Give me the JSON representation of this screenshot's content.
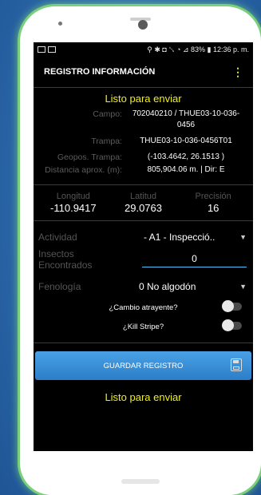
{
  "status_bar": {
    "right": "⚲ ✱ ◘ ␖ ◔ ⊿ 83% ▮ 12:36 p. m."
  },
  "app": {
    "title": "REGISTRO INFORMACIÓN",
    "menu_icon": "⋮"
  },
  "status_message": "Listo para enviar",
  "details": [
    {
      "label": "Campo:",
      "value": "702040210 / THUE03-10-036-0456"
    },
    {
      "label": "Trampa:",
      "value": "THUE03-10-036-0456T01"
    },
    {
      "label": "Geopos. Trampa:",
      "value": "(-103.4642, 26.1513 )"
    },
    {
      "label": "Distancia aprox. (m):",
      "value": "805,904.06 m. | Dir: E"
    }
  ],
  "coords": {
    "longitud": {
      "label": "Longitud",
      "value": "-110.9417"
    },
    "latitud": {
      "label": "Latitud",
      "value": "29.0763"
    },
    "precision": {
      "label": "Precisión",
      "value": "16"
    }
  },
  "form": {
    "actividad": {
      "label": "Actividad",
      "value": "- A1 - Inspecció.."
    },
    "insectos": {
      "label": "Insectos Encontrados",
      "value": "0"
    },
    "fenologia": {
      "label": "Fenología",
      "value": "0 No algodón"
    },
    "cambio_atrayente": {
      "label": "¿Cambio atrayente?",
      "checked": false
    },
    "kill_stripe": {
      "label": "¿Kill Stripe?",
      "checked": false
    }
  },
  "save_button": {
    "label": "GUARDAR REGISTRO",
    "icon": "floppy-disk-icon"
  },
  "colors": {
    "accent_text": "#f0f016",
    "button": "#3a92d8",
    "frame_glow": "#7ad07a",
    "background": "#2f6fb0"
  }
}
